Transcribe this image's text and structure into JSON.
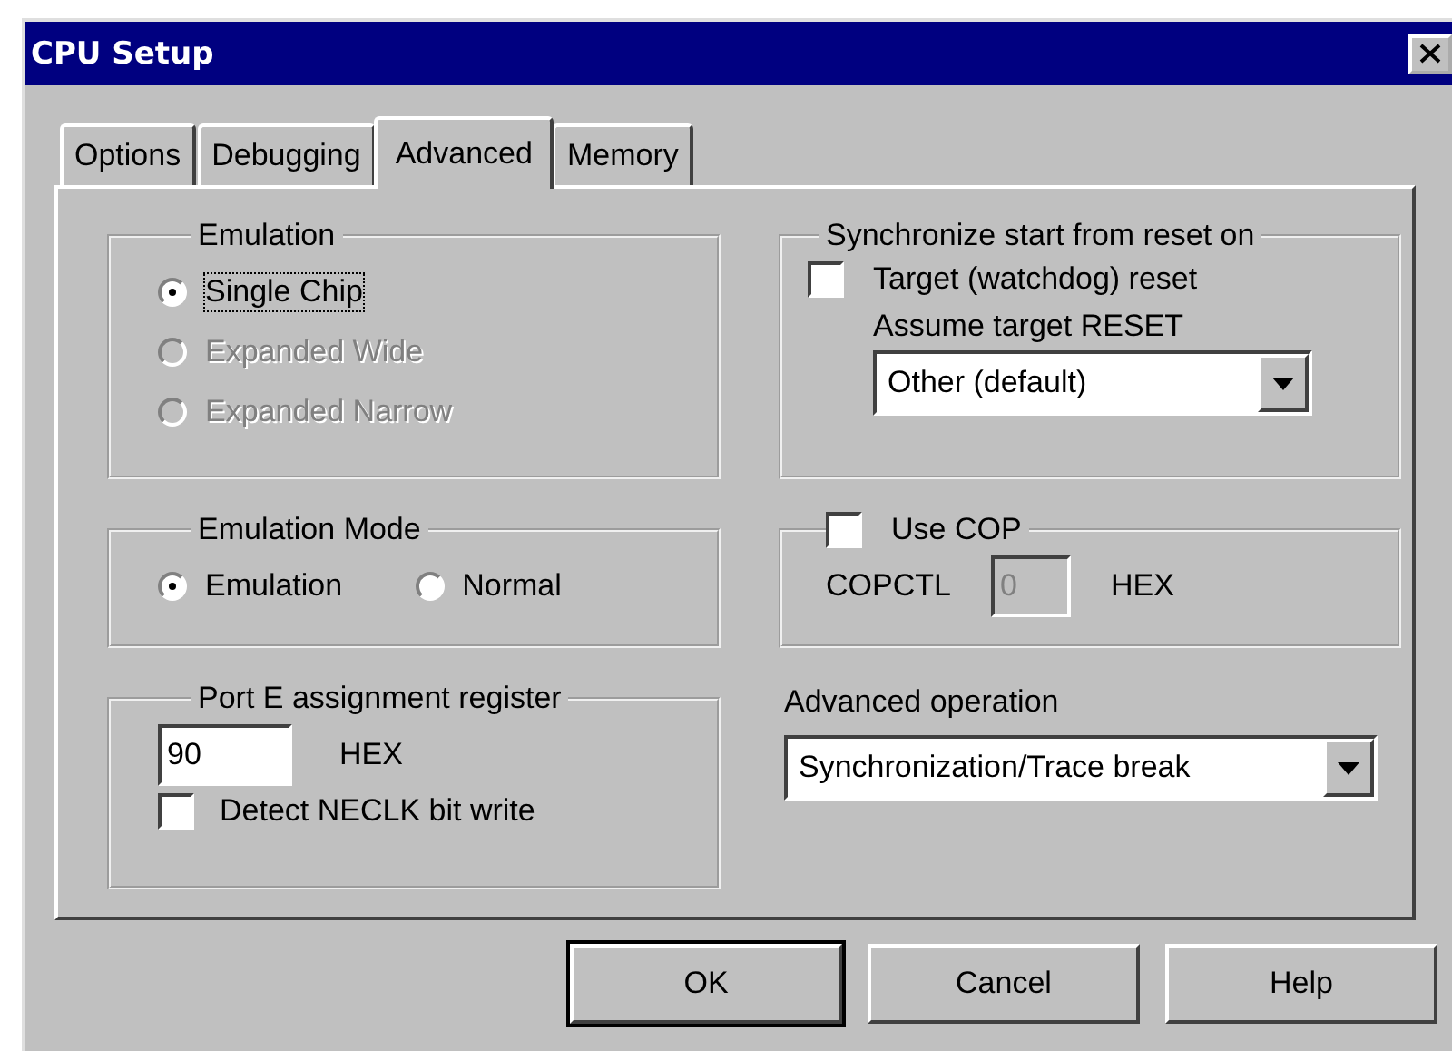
{
  "window": {
    "title": "CPU Setup"
  },
  "tabs": [
    {
      "label": "Options",
      "selected": false
    },
    {
      "label": "Debugging",
      "selected": false
    },
    {
      "label": "Advanced",
      "selected": true
    },
    {
      "label": "Memory",
      "selected": false
    }
  ],
  "emulation": {
    "label": "Emulation",
    "options": [
      {
        "label": "Single Chip",
        "selected": true,
        "disabled": false,
        "focused": true
      },
      {
        "label": "Expanded Wide",
        "selected": false,
        "disabled": true,
        "focused": false
      },
      {
        "label": "Expanded Narrow",
        "selected": false,
        "disabled": true,
        "focused": false
      }
    ]
  },
  "emulation_mode": {
    "label": "Emulation Mode",
    "options": [
      {
        "label": "Emulation",
        "selected": true
      },
      {
        "label": "Normal",
        "selected": false
      }
    ]
  },
  "port_e": {
    "label": "Port E assignment register",
    "value": "90",
    "unit": "HEX",
    "detect": {
      "label": "Detect NECLK bit write",
      "checked": false
    }
  },
  "sync": {
    "label": "Synchronize start from reset on",
    "target_reset": {
      "label": "Target (watchdog) reset",
      "checked": false
    },
    "assume_label": "Assume target RESET",
    "assume_value": "Other (default)"
  },
  "cop": {
    "label": "Use COP",
    "checked": false,
    "field_label": "COPCTL",
    "value": "0",
    "disabled": true,
    "unit": "HEX"
  },
  "advanced_operation": {
    "label": "Advanced operation",
    "value": "Synchronization/Trace break"
  },
  "buttons": [
    {
      "label": "OK",
      "default": true
    },
    {
      "label": "Cancel",
      "default": false
    },
    {
      "label": "Help",
      "default": false
    }
  ]
}
